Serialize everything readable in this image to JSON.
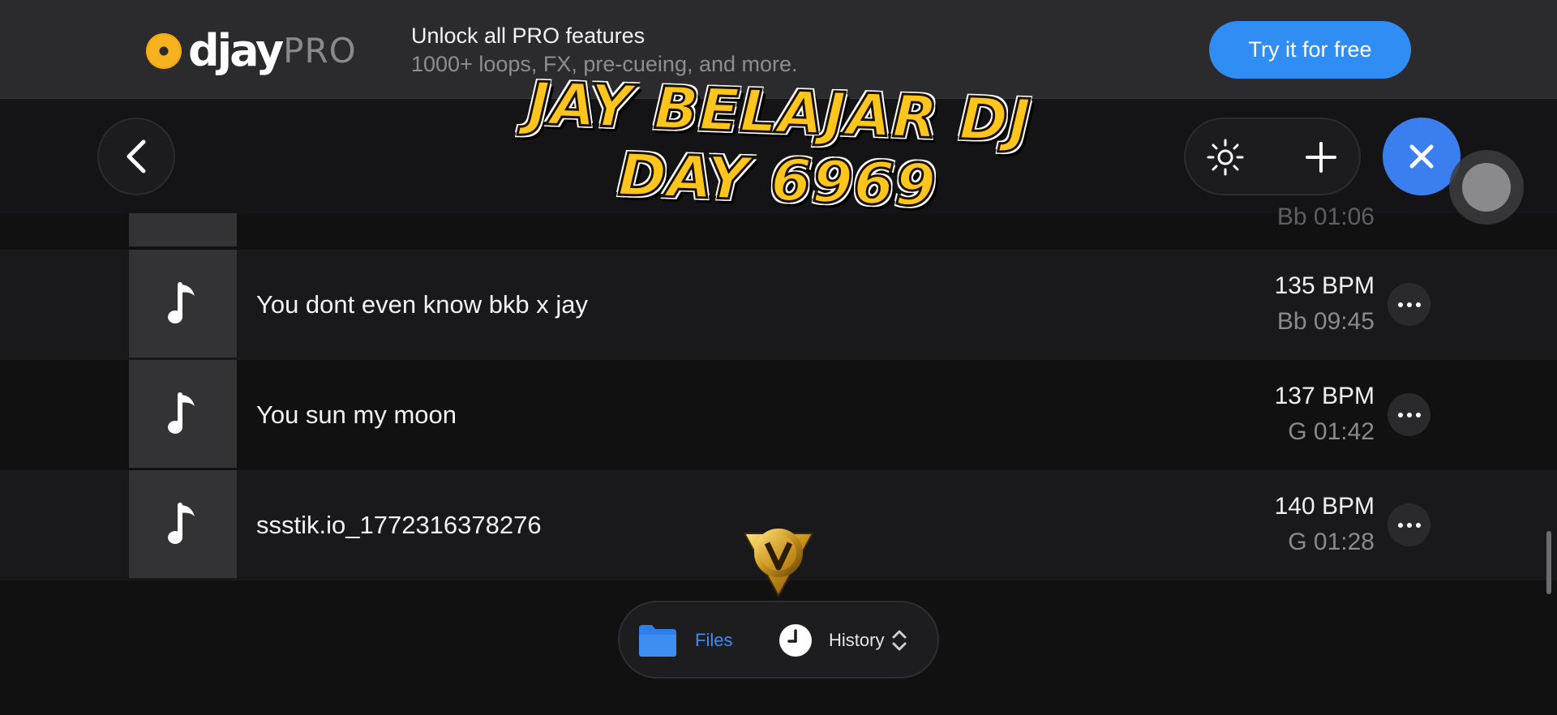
{
  "promo": {
    "logo_word": "djay",
    "logo_pro": "PRO",
    "title": "Unlock all PRO features",
    "subtitle": "1000+ loops, FX, pre-cueing, and more.",
    "cta": "Try it for free",
    "cta_color": "#2f8df3"
  },
  "nav": {
    "back_icon": "chevron-left-icon",
    "brightness_icon": "sun-icon",
    "add_icon": "plus-icon",
    "close_icon": "close-icon",
    "close_color": "#3a7ef0"
  },
  "partial_row": {
    "meta": "Bb 01:06"
  },
  "tracks": [
    {
      "title": "You dont even know bkb x jay",
      "bpm": "135 BPM",
      "keytime": "Bb  09:45"
    },
    {
      "title": "You sun my moon",
      "bpm": "137 BPM",
      "keytime": "G  01:42"
    },
    {
      "title": "ssstik.io_1772316378276",
      "bpm": "140 BPM",
      "keytime": "G  01:28"
    }
  ],
  "tabs": {
    "files": "Files",
    "history": "History",
    "active_color": "#3d8ef0"
  },
  "overlay": {
    "line1": "JAY BELAJAR DJ",
    "line2": "DAY 6969",
    "color": "#ffc51f"
  }
}
